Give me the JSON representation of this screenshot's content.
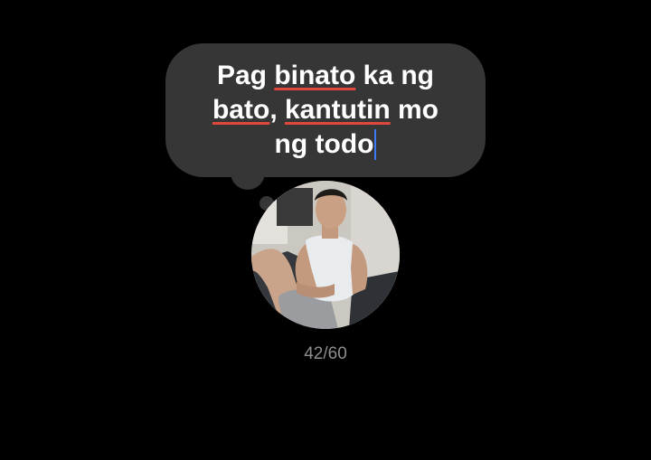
{
  "note": {
    "lines": [
      [
        {
          "text": "Pag ",
          "spellcheck": false
        },
        {
          "text": "binato",
          "spellcheck": true
        },
        {
          "text": " ka ng",
          "spellcheck": false
        }
      ],
      [
        {
          "text": "bato",
          "spellcheck": true
        },
        {
          "text": ", ",
          "spellcheck": false
        },
        {
          "text": "kantutin",
          "spellcheck": true
        },
        {
          "text": " mo",
          "spellcheck": false
        }
      ],
      [
        {
          "text": "ng todo",
          "spellcheck": false
        }
      ]
    ],
    "char_count": "42/60"
  },
  "colors": {
    "background": "#000000",
    "bubble": "#363636",
    "text": "#ffffff",
    "spellcheck_underline": "#e0483e",
    "caret": "#3d7bf5",
    "counter": "#8e8e8e"
  },
  "avatar": {
    "icon": "profile-photo"
  }
}
